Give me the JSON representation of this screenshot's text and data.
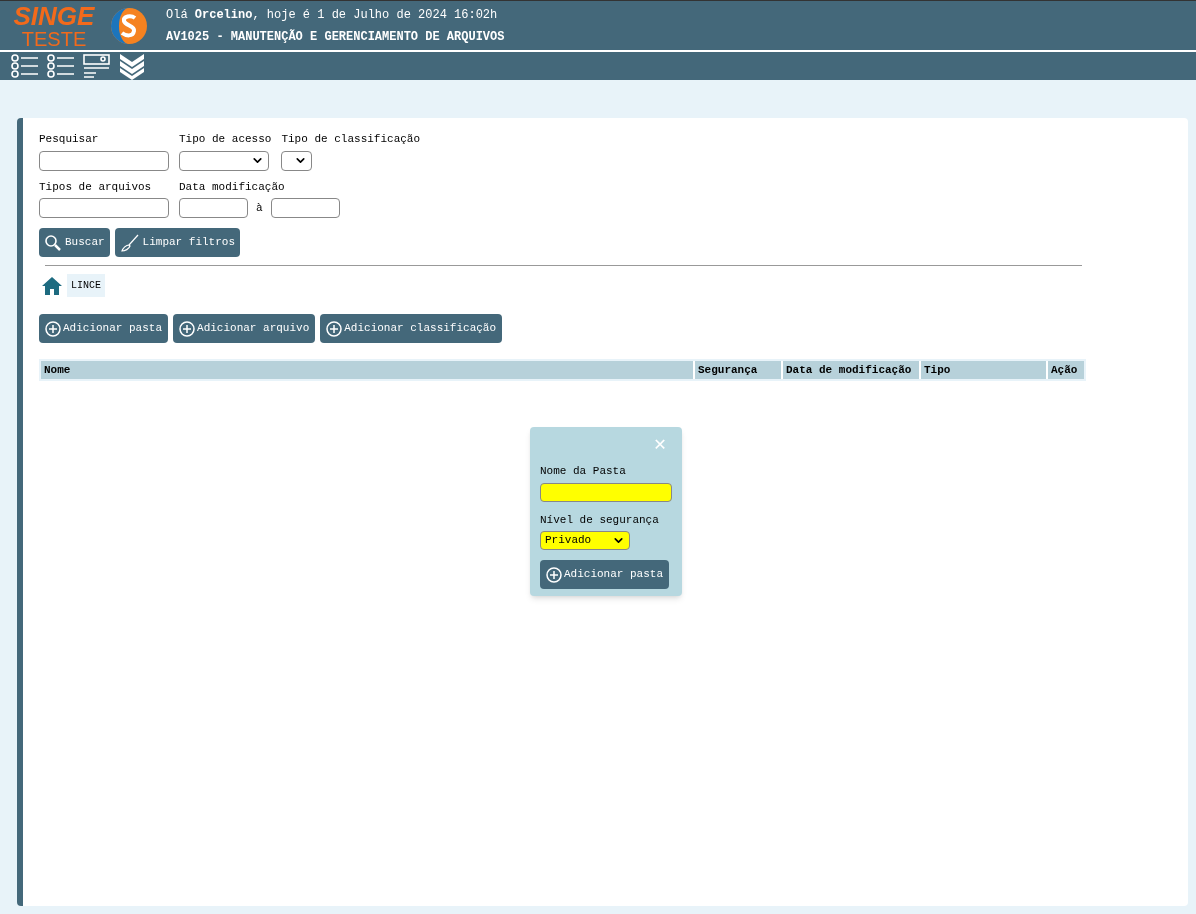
{
  "header": {
    "logo_top": "SINGE",
    "logo_bottom": "TESTE",
    "greeting": "Olá **Orcelino**, hoje é 1 de Julho de 2024 16:02h",
    "title": "AV1025 - MANUTENÇÃO E GERENCIAMENTO DE ARQUIVOS"
  },
  "filters": {
    "row1": [
      {
        "label": "Pesquisar",
        "kind": "text"
      },
      {
        "label": "Tipo de acesso",
        "kind": "select"
      },
      {
        "label": "Tipo de classificação",
        "kind": "select-small"
      }
    ],
    "row2": [
      {
        "label": "Tipos de arquivos",
        "kind": "text"
      },
      {
        "label": "Data modificação",
        "kind": "date-range",
        "separator": "à"
      }
    ]
  },
  "filter_buttons": [
    {
      "label": "Buscar",
      "kind": "search"
    },
    {
      "label": "Limpar filtros",
      "kind": "broom"
    }
  ],
  "breadcrumb": [
    "LINCE"
  ],
  "action_buttons": [
    "Adicionar pasta",
    "Adicionar arquivo",
    "Adicionar classificação"
  ],
  "table": {
    "columns": [
      "Nome",
      "Segurança",
      "Data de modificação",
      "Tipo",
      "Ação"
    ]
  },
  "dialog": {
    "close": "✕",
    "name_label": "Nome da Pasta",
    "security_label": "Nível de segurança",
    "security_value": "Privado",
    "submit": "Adicionar pasta"
  }
}
